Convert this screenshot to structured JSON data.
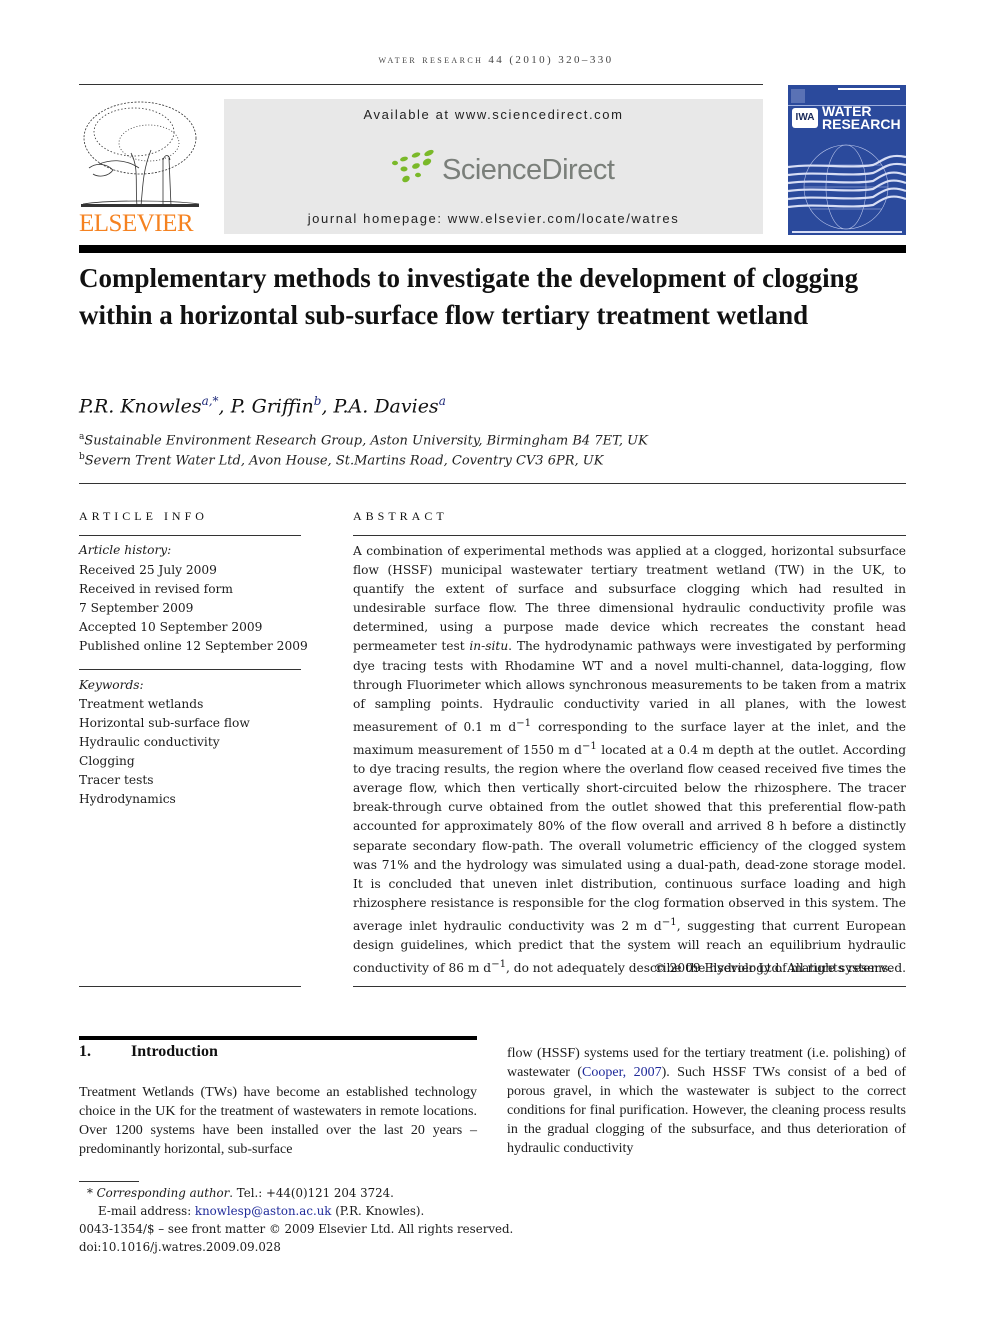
{
  "header": {
    "running_head": "WATER RESEARCH 44 (2010) 320–330",
    "publisher_logo_text": "ELSEVIER",
    "available_at": "Available at www.sciencedirect.com",
    "sciencedirect_logo_text": "ScienceDirect",
    "journal_homepage": "journal homepage: www.elsevier.com/locate/watres",
    "cover": {
      "badge": "IWA",
      "title_line1": "WATER",
      "title_line2": "RESEARCH"
    },
    "colors": {
      "elsevier_orange": "#f58220",
      "sciencedirect_green": "#7ab929",
      "cover_blue": "#2b4a9c",
      "link_blue": "#1f2a9a"
    }
  },
  "article": {
    "title": "Complementary methods to investigate the development of clogging within a horizontal sub-surface flow tertiary treatment wetland",
    "authors": [
      {
        "name": "P.R. Knowles",
        "sup": "a,*"
      },
      {
        "name": "P. Griffin",
        "sup": "b"
      },
      {
        "name": "P.A. Davies",
        "sup": "a"
      }
    ],
    "affiliations": [
      {
        "mark": "a",
        "text": "Sustainable Environment Research Group, Aston University, Birmingham B4 7ET, UK"
      },
      {
        "mark": "b",
        "text": "Severn Trent Water Ltd, Avon House, St.Martins Road, Coventry CV3 6PR, UK"
      }
    ]
  },
  "article_info": {
    "heading": "ARTICLE INFO",
    "history_label": "Article history:",
    "history": [
      "Received 25 July 2009",
      "Received in revised form",
      "7 September 2009",
      "Accepted 10 September 2009",
      "Published online 12 September 2009"
    ],
    "keywords_label": "Keywords:",
    "keywords": [
      "Treatment wetlands",
      "Horizontal sub-surface flow",
      "Hydraulic conductivity",
      "Clogging",
      "Tracer tests",
      "Hydrodynamics"
    ]
  },
  "abstract": {
    "heading": "ABSTRACT",
    "p1": "A combination of experimental methods was applied at a clogged, horizontal subsurface flow (HSSF) municipal wastewater tertiary treatment wetland (TW) in the UK, to quantify the extent of surface and subsurface clogging which had resulted in undesirable surface flow. The three dimensional hydraulic conductivity profile was determined, using a purpose made device which recreates the constant head permeameter test ",
    "p1_italic": "in-situ",
    "p2": ". The hydrodynamic pathways were investigated by performing dye tracing tests with Rhodamine WT and a novel multi-channel, data-logging, flow through Fluorimeter which allows synchronous measurements to be taken from a matrix of sampling points. Hydraulic conductivity varied in all planes, with the lowest measurement of 0.1 m d",
    "p3": " corresponding to the surface layer at the inlet, and the maximum measurement of 1550 m d",
    "p4": " located at a 0.4 m depth at the outlet. According to dye tracing results, the region where the overland flow ceased received five times the average flow, which then vertically short-circuited below the rhizosphere. The tracer break-through curve obtained from the outlet showed that this preferential flow-path accounted for approximately 80% of the flow overall and arrived 8 h before a distinctly separate secondary flow-path. The overall volumetric efficiency of the clogged system was 71% and the hydrology was simulated using a dual-path, dead-zone storage model. It is concluded that uneven inlet distribution, continuous surface loading and high rhizosphere resistance is responsible for the clog formation observed in this system. The average inlet hydraulic conductivity was 2 m d",
    "p5": ", suggesting that current European design guidelines, which predict that the system will reach an equilibrium hydraulic conductivity of 86 m d",
    "p6": ", do not adequately describe the hydrology of mature systems.",
    "exp": "−1",
    "copyright": "© 2009 Elsevier Ltd. All rights reserved."
  },
  "introduction": {
    "number": "1.",
    "heading": "Introduction",
    "left_text": "Treatment Wetlands (TWs) have become an established technology choice in the UK for the treatment of wastewaters in remote locations. Over 1200 systems have been installed over the last 20 years – predominantly horizontal, sub-surface",
    "right_text_a": "flow (HSSF) systems used for the tertiary treatment (i.e. polishing) of wastewater (",
    "right_citation": "Cooper, 2007",
    "right_text_b": "). Such HSSF TWs consist of a bed of porous gravel, in which the wastewater is subject to the correct conditions for final purification. However, the cleaning process results in the gradual clogging of the subsurface, and thus deterioration of hydraulic conductivity"
  },
  "footnotes": {
    "star": "*",
    "corr_label": "Corresponding author",
    "corr_tel": ". Tel.: +44(0)121 204 3724.",
    "email_label": "E-mail address: ",
    "email": "knowlesp@aston.ac.uk",
    "email_suffix": " (P.R. Knowles).",
    "issn_line": "0043-1354/$ – see front matter © 2009 Elsevier Ltd. All rights reserved.",
    "doi": "doi:10.1016/j.watres.2009.09.028"
  }
}
